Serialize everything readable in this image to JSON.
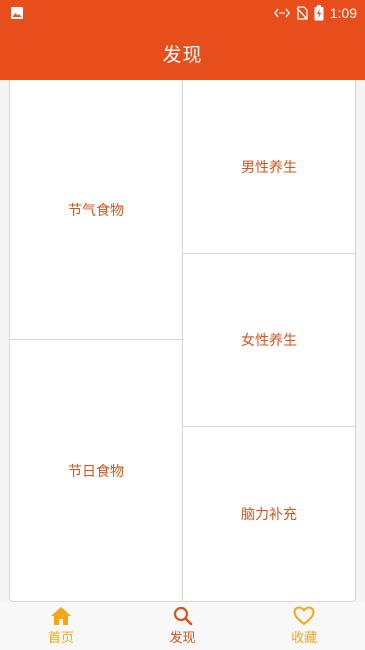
{
  "status_bar": {
    "time": "1:09",
    "icons": [
      "image-icon",
      "data-transfer-icon",
      "no-sim-icon",
      "battery-charging-icon"
    ]
  },
  "app_bar": {
    "title": "发现"
  },
  "tiles": {
    "left": [
      {
        "label": "节气食物"
      },
      {
        "label": "节日食物"
      }
    ],
    "right": [
      {
        "label": "男性养生"
      },
      {
        "label": "女性养生"
      },
      {
        "label": "脑力补充"
      }
    ]
  },
  "bottom_nav": {
    "items": [
      {
        "label": "首页",
        "icon": "home-icon",
        "color": "#f2a716"
      },
      {
        "label": "发现",
        "icon": "search-icon",
        "color": "#d3551f",
        "active": true
      },
      {
        "label": "收藏",
        "icon": "heart-icon",
        "color": "#f2a716"
      }
    ]
  },
  "colors": {
    "primary": "#e84e1c",
    "tile_text": "#d3551f",
    "nav_accent": "#f2a716"
  }
}
